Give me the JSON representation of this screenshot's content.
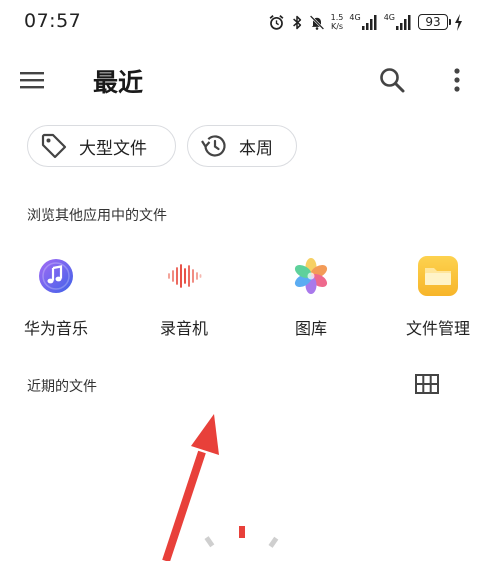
{
  "status": {
    "time": "07:57",
    "net_speed_value": "1.5",
    "net_speed_unit": "K/s",
    "sim1_label": "4G",
    "sim2_label": "4G",
    "battery": "93"
  },
  "appbar": {
    "title": "最近"
  },
  "chips": [
    {
      "label": "大型文件",
      "icon": "tag-icon"
    },
    {
      "label": "本周",
      "icon": "history-icon"
    }
  ],
  "browse": {
    "title": "浏览其他应用中的文件",
    "apps": [
      {
        "label": "华为音乐",
        "icon": "music-app-icon"
      },
      {
        "label": "录音机",
        "icon": "recorder-app-icon"
      },
      {
        "label": "图库",
        "icon": "gallery-app-icon"
      },
      {
        "label": "文件管理",
        "icon": "file-manager-app-icon"
      }
    ]
  },
  "recent": {
    "title": "近期的文件",
    "view_toggle_icon": "grid-view-icon"
  },
  "colors": {
    "accent_red": "#e8403a",
    "chip_border": "#dadce0",
    "folder_yellow": "#f9c23c"
  }
}
